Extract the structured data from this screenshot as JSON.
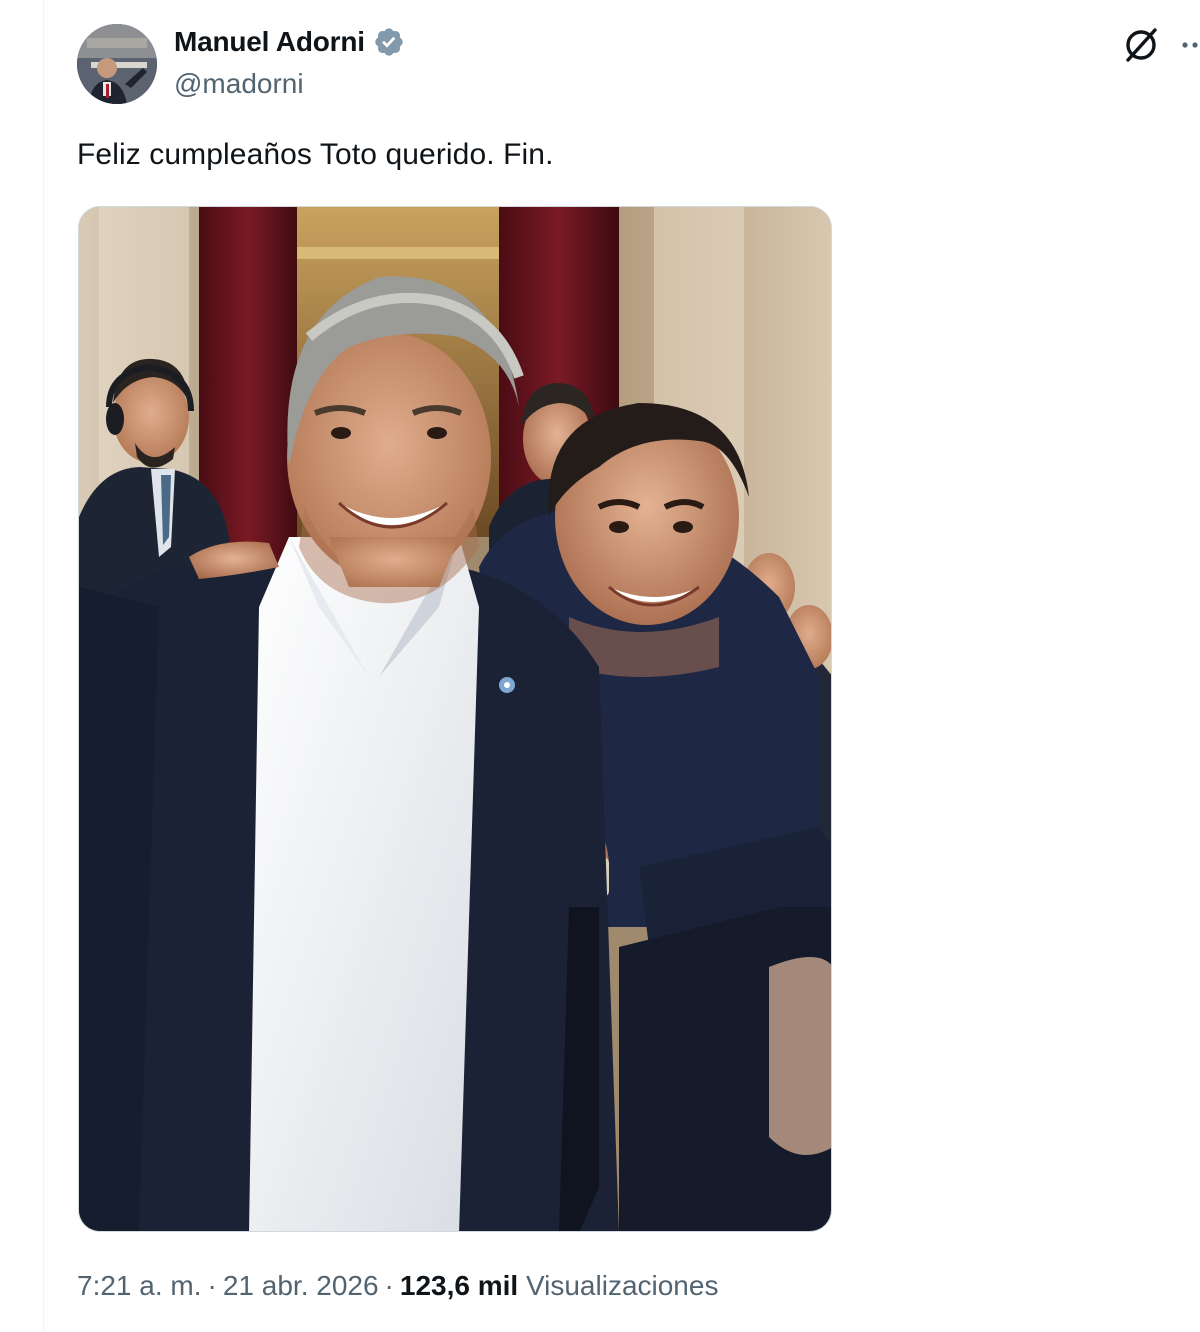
{
  "author": {
    "name": "Manuel Adorni",
    "handle": "@madorni",
    "verified": true,
    "verified_color": "#829aab"
  },
  "avatar": {
    "icon": "profile-photo"
  },
  "header_actions": {
    "grok_icon": "grok-icon",
    "more_icon": "more-dots-icon"
  },
  "tweet": {
    "text": "Feliz cumpleaños Toto querido. Fin.",
    "photo_icon": "attached-photo"
  },
  "meta": {
    "time": "7:21 a. m.",
    "separator": "·",
    "date": "21 abr. 2026",
    "views_count": "123,6 mil",
    "views_label": "Visualizaciones"
  },
  "colors": {
    "text_primary": "#0f1419",
    "text_secondary": "#536471",
    "border": "#cfd9de"
  }
}
